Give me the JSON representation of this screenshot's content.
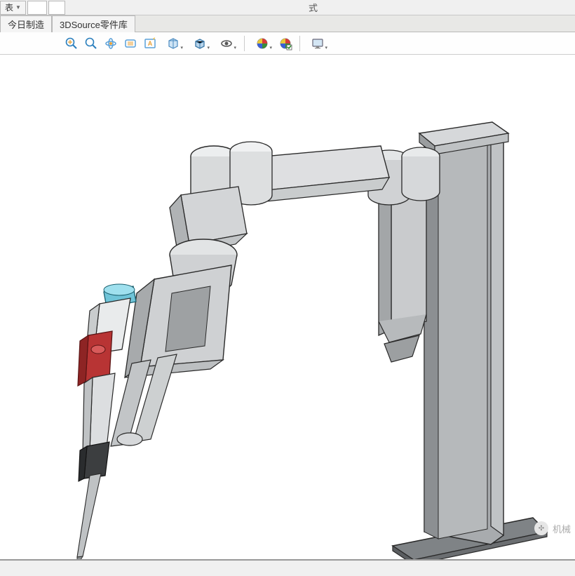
{
  "topbar": {
    "left_label": "表",
    "center_label": "式"
  },
  "tabs": {
    "t1": "今日制造",
    "t2": "3DSource零件库"
  },
  "toolbar": {
    "zoom_in": "zoom-in-icon",
    "zoom_out": "zoom-out-icon",
    "orbit": "orbit-icon",
    "pan": "pan-icon",
    "zoom_all": "zoom-all-icon",
    "fit": "fit-icon",
    "view_style": "view-style-icon",
    "visibility": "visibility-icon",
    "appearance1": "appearance-color-icon",
    "appearance2": "appearance-check-icon",
    "screen": "screen-icon"
  },
  "watermark": {
    "prefix": "",
    "text": "机械"
  }
}
